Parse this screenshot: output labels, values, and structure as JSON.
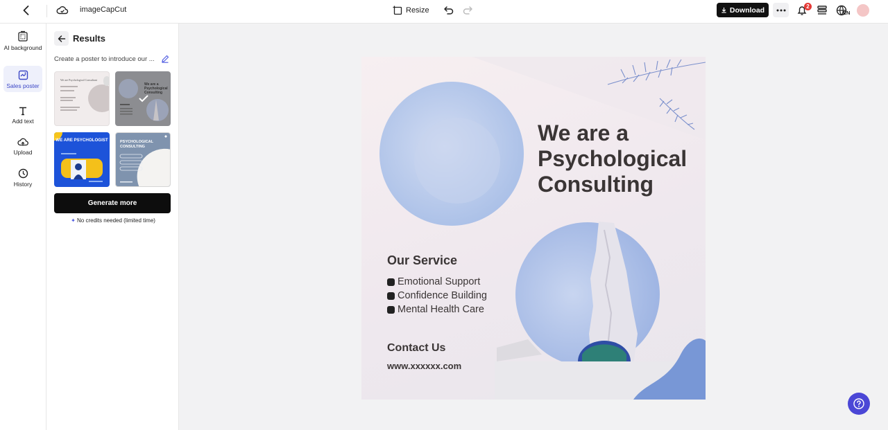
{
  "topbar": {
    "project_name": "imageCapCut Co",
    "resize_label": "Resize",
    "download_label": "Download",
    "notification_count": "2",
    "language": "EN"
  },
  "rail": {
    "items": [
      {
        "label": "AI background",
        "icon": "ai-background-icon"
      },
      {
        "label": "Sales poster",
        "icon": "sales-poster-icon",
        "active": true
      },
      {
        "label": "Add text",
        "icon": "text-icon"
      },
      {
        "label": "Upload",
        "icon": "upload-cloud-icon"
      },
      {
        "label": "History",
        "icon": "clock-icon"
      }
    ]
  },
  "panel": {
    "title": "Results",
    "prompt": "Create a poster to introduce our ...",
    "generate_label": "Generate more",
    "credits_note": "No credits needed (limited time)",
    "thumbs": [
      {
        "text": "We are Psychological Consultant"
      },
      {
        "text": "We are a Psychological Consulting",
        "selected": true
      },
      {
        "text": "WE ARE PSYCHOLOGIST"
      },
      {
        "text": "PSYCHOLOGICAL CONSULTING"
      }
    ]
  },
  "poster": {
    "headline": "We are a Psychological Consulting",
    "service_title": "Our Service",
    "services": [
      "Emotional Support",
      "Confidence Building",
      "Mental Health Care"
    ],
    "contact_title": "Contact Us",
    "url": "www.xxxxxx.com"
  },
  "colors": {
    "accent": "#4b47d6",
    "poster_blue": "#a8bfe6",
    "download_bg": "#111111"
  }
}
